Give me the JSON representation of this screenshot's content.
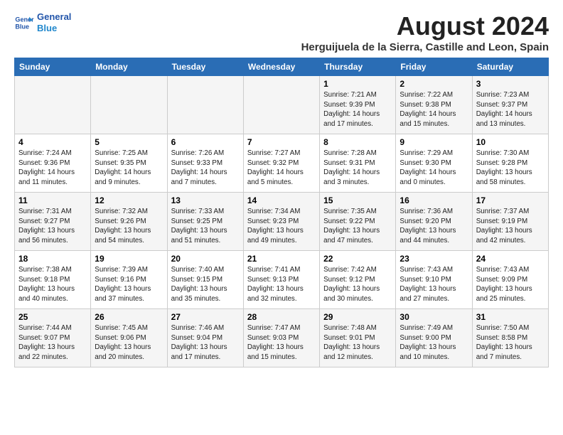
{
  "header": {
    "logo_line1": "General",
    "logo_line2": "Blue",
    "title": "August 2024",
    "subtitle": "Herguijuela de la Sierra, Castille and Leon, Spain"
  },
  "weekdays": [
    "Sunday",
    "Monday",
    "Tuesday",
    "Wednesday",
    "Thursday",
    "Friday",
    "Saturday"
  ],
  "weeks": [
    [
      {
        "day": "",
        "info": ""
      },
      {
        "day": "",
        "info": ""
      },
      {
        "day": "",
        "info": ""
      },
      {
        "day": "",
        "info": ""
      },
      {
        "day": "1",
        "info": "Sunrise: 7:21 AM\nSunset: 9:39 PM\nDaylight: 14 hours\nand 17 minutes."
      },
      {
        "day": "2",
        "info": "Sunrise: 7:22 AM\nSunset: 9:38 PM\nDaylight: 14 hours\nand 15 minutes."
      },
      {
        "day": "3",
        "info": "Sunrise: 7:23 AM\nSunset: 9:37 PM\nDaylight: 14 hours\nand 13 minutes."
      }
    ],
    [
      {
        "day": "4",
        "info": "Sunrise: 7:24 AM\nSunset: 9:36 PM\nDaylight: 14 hours\nand 11 minutes."
      },
      {
        "day": "5",
        "info": "Sunrise: 7:25 AM\nSunset: 9:35 PM\nDaylight: 14 hours\nand 9 minutes."
      },
      {
        "day": "6",
        "info": "Sunrise: 7:26 AM\nSunset: 9:33 PM\nDaylight: 14 hours\nand 7 minutes."
      },
      {
        "day": "7",
        "info": "Sunrise: 7:27 AM\nSunset: 9:32 PM\nDaylight: 14 hours\nand 5 minutes."
      },
      {
        "day": "8",
        "info": "Sunrise: 7:28 AM\nSunset: 9:31 PM\nDaylight: 14 hours\nand 3 minutes."
      },
      {
        "day": "9",
        "info": "Sunrise: 7:29 AM\nSunset: 9:30 PM\nDaylight: 14 hours\nand 0 minutes."
      },
      {
        "day": "10",
        "info": "Sunrise: 7:30 AM\nSunset: 9:28 PM\nDaylight: 13 hours\nand 58 minutes."
      }
    ],
    [
      {
        "day": "11",
        "info": "Sunrise: 7:31 AM\nSunset: 9:27 PM\nDaylight: 13 hours\nand 56 minutes."
      },
      {
        "day": "12",
        "info": "Sunrise: 7:32 AM\nSunset: 9:26 PM\nDaylight: 13 hours\nand 54 minutes."
      },
      {
        "day": "13",
        "info": "Sunrise: 7:33 AM\nSunset: 9:25 PM\nDaylight: 13 hours\nand 51 minutes."
      },
      {
        "day": "14",
        "info": "Sunrise: 7:34 AM\nSunset: 9:23 PM\nDaylight: 13 hours\nand 49 minutes."
      },
      {
        "day": "15",
        "info": "Sunrise: 7:35 AM\nSunset: 9:22 PM\nDaylight: 13 hours\nand 47 minutes."
      },
      {
        "day": "16",
        "info": "Sunrise: 7:36 AM\nSunset: 9:20 PM\nDaylight: 13 hours\nand 44 minutes."
      },
      {
        "day": "17",
        "info": "Sunrise: 7:37 AM\nSunset: 9:19 PM\nDaylight: 13 hours\nand 42 minutes."
      }
    ],
    [
      {
        "day": "18",
        "info": "Sunrise: 7:38 AM\nSunset: 9:18 PM\nDaylight: 13 hours\nand 40 minutes."
      },
      {
        "day": "19",
        "info": "Sunrise: 7:39 AM\nSunset: 9:16 PM\nDaylight: 13 hours\nand 37 minutes."
      },
      {
        "day": "20",
        "info": "Sunrise: 7:40 AM\nSunset: 9:15 PM\nDaylight: 13 hours\nand 35 minutes."
      },
      {
        "day": "21",
        "info": "Sunrise: 7:41 AM\nSunset: 9:13 PM\nDaylight: 13 hours\nand 32 minutes."
      },
      {
        "day": "22",
        "info": "Sunrise: 7:42 AM\nSunset: 9:12 PM\nDaylight: 13 hours\nand 30 minutes."
      },
      {
        "day": "23",
        "info": "Sunrise: 7:43 AM\nSunset: 9:10 PM\nDaylight: 13 hours\nand 27 minutes."
      },
      {
        "day": "24",
        "info": "Sunrise: 7:43 AM\nSunset: 9:09 PM\nDaylight: 13 hours\nand 25 minutes."
      }
    ],
    [
      {
        "day": "25",
        "info": "Sunrise: 7:44 AM\nSunset: 9:07 PM\nDaylight: 13 hours\nand 22 minutes."
      },
      {
        "day": "26",
        "info": "Sunrise: 7:45 AM\nSunset: 9:06 PM\nDaylight: 13 hours\nand 20 minutes."
      },
      {
        "day": "27",
        "info": "Sunrise: 7:46 AM\nSunset: 9:04 PM\nDaylight: 13 hours\nand 17 minutes."
      },
      {
        "day": "28",
        "info": "Sunrise: 7:47 AM\nSunset: 9:03 PM\nDaylight: 13 hours\nand 15 minutes."
      },
      {
        "day": "29",
        "info": "Sunrise: 7:48 AM\nSunset: 9:01 PM\nDaylight: 13 hours\nand 12 minutes."
      },
      {
        "day": "30",
        "info": "Sunrise: 7:49 AM\nSunset: 9:00 PM\nDaylight: 13 hours\nand 10 minutes."
      },
      {
        "day": "31",
        "info": "Sunrise: 7:50 AM\nSunset: 8:58 PM\nDaylight: 13 hours\nand 7 minutes."
      }
    ]
  ]
}
